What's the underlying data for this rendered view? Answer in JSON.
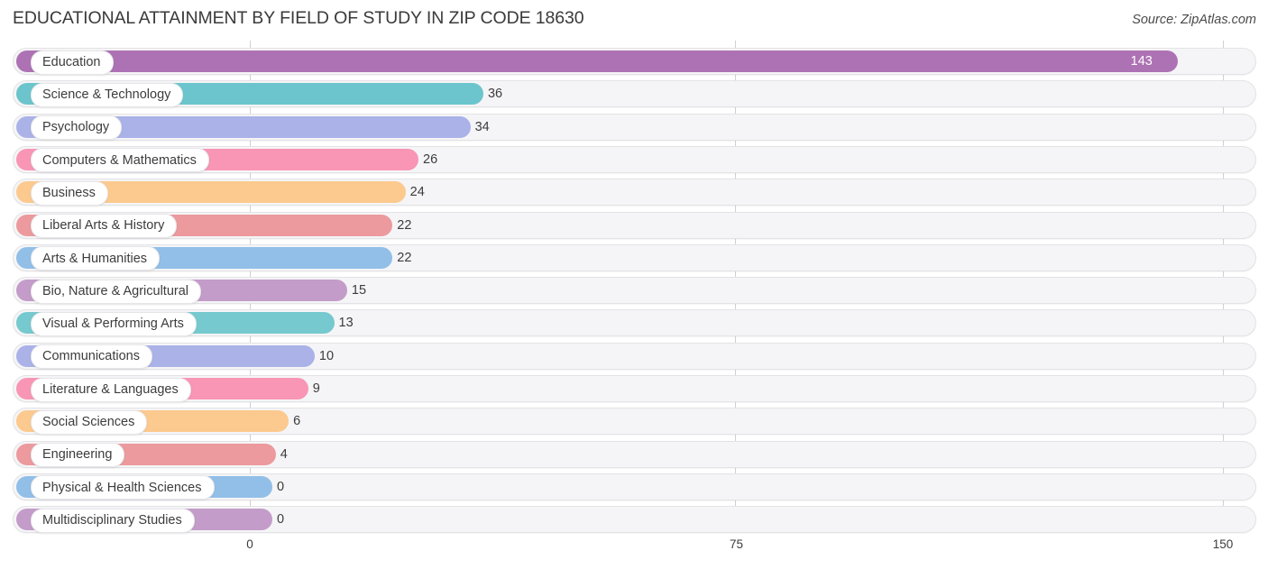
{
  "header": {
    "title": "EDUCATIONAL ATTAINMENT BY FIELD OF STUDY IN ZIP CODE 18630",
    "source": "Source: ZipAtlas.com"
  },
  "chart_data": {
    "type": "bar",
    "orientation": "horizontal",
    "title": "EDUCATIONAL ATTAINMENT BY FIELD OF STUDY IN ZIP CODE 18630",
    "subtitle": "",
    "xlabel": "",
    "ylabel": "",
    "xlim": [
      0,
      150
    ],
    "ylim": null,
    "grid": true,
    "legend": null,
    "xticks": [
      "0",
      "75",
      "150"
    ],
    "xtick_values": [
      0,
      75,
      150
    ],
    "categories": [
      "Education",
      "Science & Technology",
      "Psychology",
      "Computers & Mathematics",
      "Business",
      "Liberal Arts & History",
      "Arts & Humanities",
      "Bio, Nature & Agricultural",
      "Visual & Performing Arts",
      "Communications",
      "Literature & Languages",
      "Social Sciences",
      "Engineering",
      "Physical & Health Sciences",
      "Multidisciplinary Studies"
    ],
    "values": [
      143,
      36,
      34,
      26,
      24,
      22,
      22,
      15,
      13,
      10,
      9,
      6,
      4,
      0,
      0
    ],
    "value_labels": [
      "143",
      "36",
      "34",
      "26",
      "24",
      "22",
      "22",
      "15",
      "13",
      "10",
      "9",
      "6",
      "4",
      "0",
      "0"
    ],
    "colors": [
      "#ad72b4",
      "#6cc5cc",
      "#aab2e8",
      "#f995b5",
      "#fcc98e",
      "#ec9a9e",
      "#91bfe8",
      "#c39cc9",
      "#76c9ce",
      "#aab2e8",
      "#f995b5",
      "#fcc98e",
      "#ec9a9e",
      "#91bfe8",
      "#c39cc9"
    ]
  },
  "style": {
    "track_fill": "#f5f5f7",
    "track_border": "#e3e3e6",
    "gridline_color": "#d0d0d4",
    "text_color": "#3c3c3c"
  }
}
